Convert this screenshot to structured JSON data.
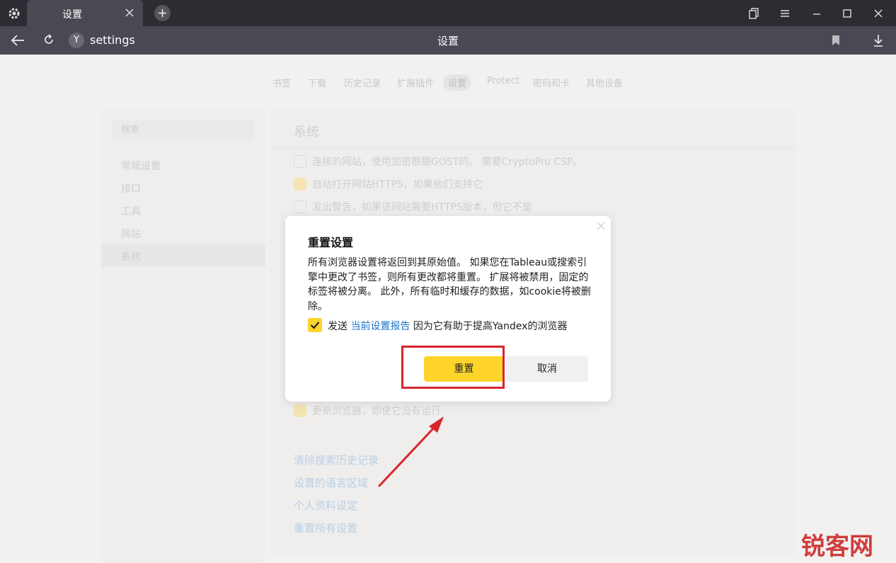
{
  "browser": {
    "tab_title": "设置",
    "address_text": "settings",
    "page_title": "设置",
    "logo_letter": "Y"
  },
  "topnav": [
    "书签",
    "下载",
    "历史记录",
    "扩展插件",
    "设置",
    "Protect",
    "密码和卡",
    "其他设备"
  ],
  "topnav_active": "设置",
  "sidebar": {
    "search_placeholder": "搜索",
    "items": [
      "常规设置",
      "接口",
      "工具",
      "网站",
      "系统"
    ],
    "active": "系统"
  },
  "main": {
    "section_title": "系统",
    "options": [
      {
        "label": "连接的网站，使用加密根据GOST的。 需要CryptoPro CSP。",
        "checked": false
      },
      {
        "label": "自动打开网站HTTPS，如果他们支持它",
        "checked": true
      },
      {
        "label": "发出警告，如果该网站需要HTTPS版本，但它不是",
        "checked": false
      },
      {
        "label": "更新浏览器，即使它没有运行",
        "checked": true
      }
    ],
    "links": [
      "清除搜索历史记录",
      "设置的语言区域",
      "个人资料设定",
      "重置所有设置"
    ]
  },
  "dialog": {
    "title": "重置设置",
    "body": "所有浏览器设置将返回到其原始值。 如果您在Tableau或搜索引擎中更改了书签，则所有更改都将重置。 扩展将被禁用，固定的标签将被分离。 此外，所有临时和缓存的数据，如cookie将被删除。",
    "check_prefix": "发送",
    "check_link": "当前设置报告",
    "check_suffix": "因为它有助于提高Yandex的浏览器",
    "checked": true,
    "reset_label": "重置",
    "cancel_label": "取消"
  },
  "colors": {
    "accent": "#fed42b",
    "link": "#1b74c6",
    "annotation": "#d9252b",
    "titlebar": "#2e2c33"
  }
}
